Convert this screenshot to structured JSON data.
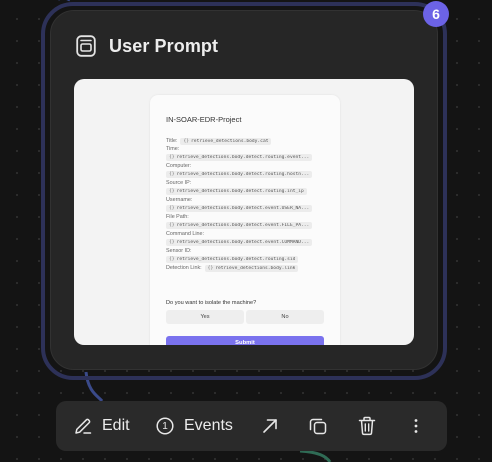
{
  "node": {
    "title": "User Prompt",
    "badge": "6",
    "icon": "user-prompt-icon"
  },
  "form": {
    "title": "IN-SOAR-EDR-Project",
    "fields": [
      {
        "label": "Title:",
        "value": "retrieve_detections.body.cat",
        "inline": true
      },
      {
        "label": "Time:",
        "value": "retrieve_detections.body.detect.routing.event...",
        "inline": false
      },
      {
        "label": "Computer:",
        "value": "retrieve_detections.body.detect.routing.hostn...",
        "inline": false
      },
      {
        "label": "Source IP:",
        "value": "retrieve_detections.body.detect.routing.int_ip",
        "inline": false
      },
      {
        "label": "Username:",
        "value": "retrieve_detections.body.detect.event.USER_NA...",
        "inline": false
      },
      {
        "label": "File Path:",
        "value": "retrieve_detections.body.detect.event.FILE_PA...",
        "inline": false
      },
      {
        "label": "Command Line:",
        "value": "retrieve_detections.body.detect.event.COMMAND...",
        "inline": false
      },
      {
        "label": "Sensor ID:",
        "value": "retrieve_detections.body.detect.routing.sid",
        "inline": false
      },
      {
        "label": "Detection Link:",
        "value": "retrieve_detections.body.link",
        "inline": true
      }
    ],
    "chip_icon": "{}",
    "question": "Do you want to isolate the machine?",
    "yes_label": "Yes",
    "no_label": "No",
    "submit_label": "Submit"
  },
  "toolbar": {
    "edit_label": "Edit",
    "events_label": "Events",
    "events_count": "1"
  },
  "colors": {
    "accent": "#6c63e6",
    "outline": "#2d3158",
    "card": "#262626",
    "connector": "#3a4a8a",
    "connector_green": "#2f6b55"
  }
}
